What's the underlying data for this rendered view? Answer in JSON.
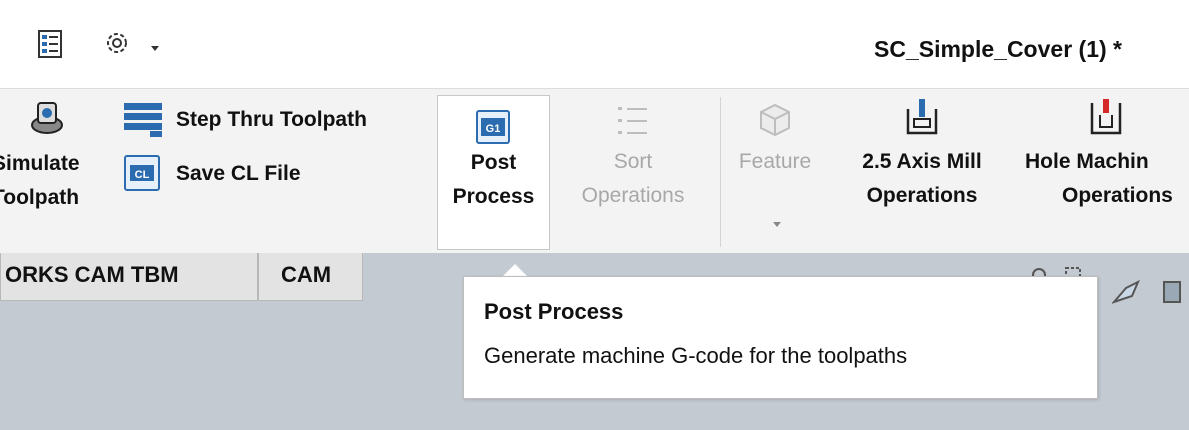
{
  "titlebar": {
    "document_title": "SC_Simple_Cover (1) *",
    "icons": [
      "properties-icon",
      "gear-icon",
      "dropdown-caret-icon"
    ]
  },
  "ribbon": {
    "simulate": {
      "label_line1": "Simulate",
      "label_line2": "Toolpath",
      "icon": "simulate-toolpath-icon"
    },
    "step_thru": {
      "label": "Step Thru Toolpath",
      "icon": "step-thru-toolpath-icon"
    },
    "save_cl": {
      "label": "Save CL File",
      "icon": "save-cl-file-icon",
      "icon_text": "CL"
    },
    "post_process": {
      "label_line1": "Post",
      "label_line2": "Process",
      "icon": "post-process-icon",
      "icon_text": "G1"
    },
    "sort_operations": {
      "label_line1": "Sort",
      "label_line2": "Operations",
      "icon": "sort-operations-icon",
      "enabled": false
    },
    "feature": {
      "label": "Feature",
      "icon": "feature-icon",
      "enabled": false
    },
    "axis_mill": {
      "label_line1": "2.5 Axis Mill",
      "label_line2": "Operations",
      "icon": "axis-mill-icon"
    },
    "hole_machining": {
      "label_line1": "Hole Machin",
      "label_line2": "Operations",
      "icon": "hole-machining-icon"
    }
  },
  "tabs": [
    {
      "label": "ORKS CAM TBM"
    },
    {
      "label": "CAM"
    }
  ],
  "tooltip": {
    "title": "Post Process",
    "description": "Generate machine G-code for the toolpaths"
  },
  "colors": {
    "ribbon_bg": "#f3f3f3",
    "viewport_bg": "#c4cad1",
    "icon_blue": "#2b6cb0",
    "disabled_text": "#a8a8a8"
  }
}
